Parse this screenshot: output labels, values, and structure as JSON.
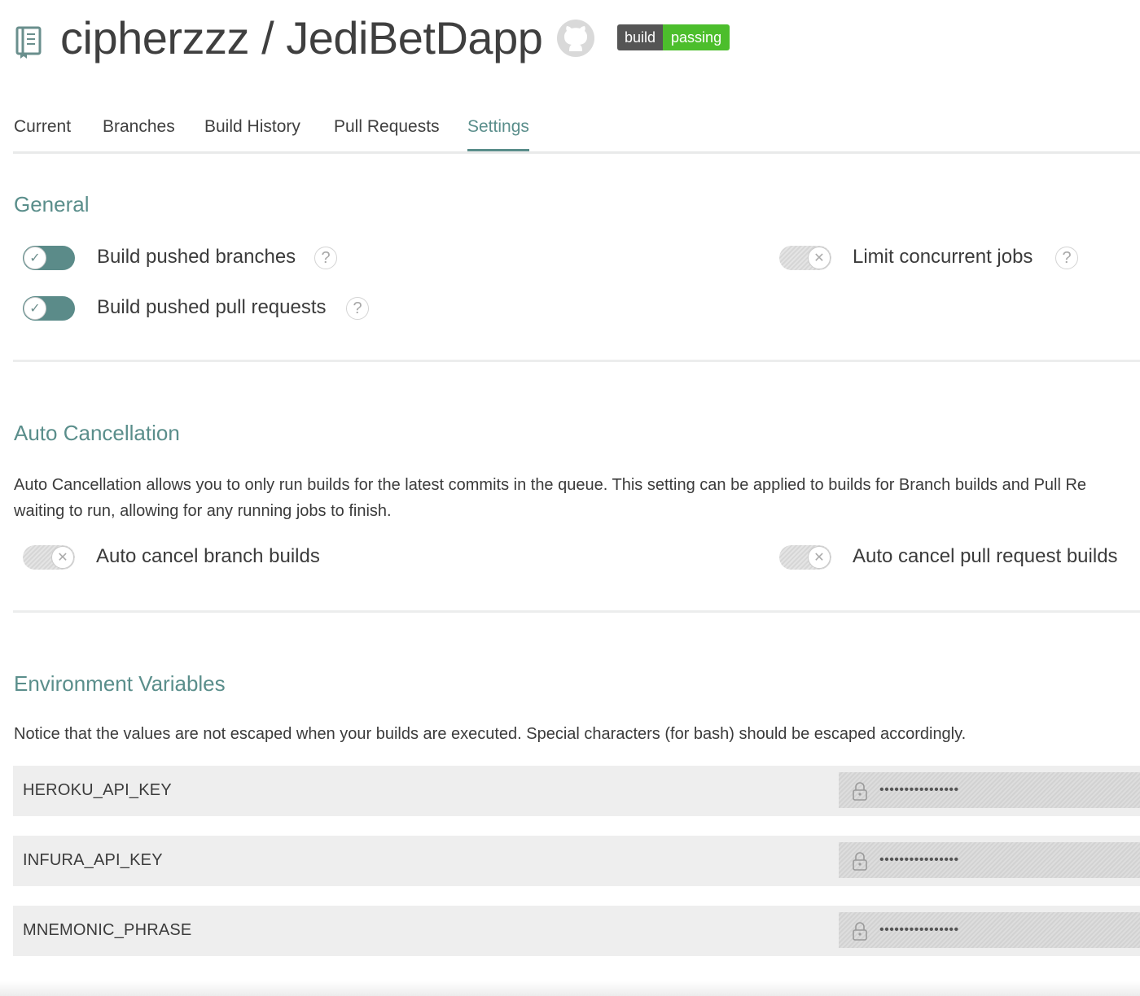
{
  "header": {
    "repo_owner": "cipherzzz",
    "repo_name": "JediBetDapp",
    "repo_title": "cipherzzz / JediBetDapp",
    "badge_left": "build",
    "badge_right": "passing"
  },
  "tabs": [
    {
      "label": "Current"
    },
    {
      "label": "Branches"
    },
    {
      "label": "Build History"
    },
    {
      "label": "Pull Requests"
    },
    {
      "label": "Settings",
      "active": true
    }
  ],
  "general": {
    "title": "General",
    "options": [
      {
        "label": "Build pushed branches",
        "enabled": true,
        "help": "?"
      },
      {
        "label": "Build pushed pull requests",
        "enabled": true,
        "help": "?"
      },
      {
        "label": "Limit concurrent jobs",
        "enabled": false,
        "help": "?"
      }
    ]
  },
  "auto_cancellation": {
    "title": "Auto Cancellation",
    "description_line1": "Auto Cancellation allows you to only run builds for the latest commits in the queue. This setting can be applied to builds for Branch builds and Pull Re",
    "description_line2": "waiting to run, allowing for any running jobs to finish.",
    "options": [
      {
        "label": "Auto cancel branch builds",
        "enabled": false
      },
      {
        "label": "Auto cancel pull request builds",
        "enabled": false
      }
    ]
  },
  "env_vars": {
    "title": "Environment Variables",
    "notice": "Notice that the values are not escaped when your builds are executed. Special characters (for bash) should be escaped accordingly.",
    "rows": [
      {
        "name": "HEROKU_API_KEY",
        "value": "••••••••••••••••"
      },
      {
        "name": "INFURA_API_KEY",
        "value": "••••••••••••••••"
      },
      {
        "name": "MNEMONIC_PHRASE",
        "value": "••••••••••••••••"
      }
    ]
  },
  "colors": {
    "accent": "#5a8e8b",
    "badge_pass": "#4cbe2c",
    "badge_label": "#555555"
  },
  "icons": {
    "repo": "repo-book-icon",
    "github": "github-icon",
    "check": "check-icon",
    "x": "x-icon",
    "help": "help-icon",
    "lock": "lock-icon"
  }
}
